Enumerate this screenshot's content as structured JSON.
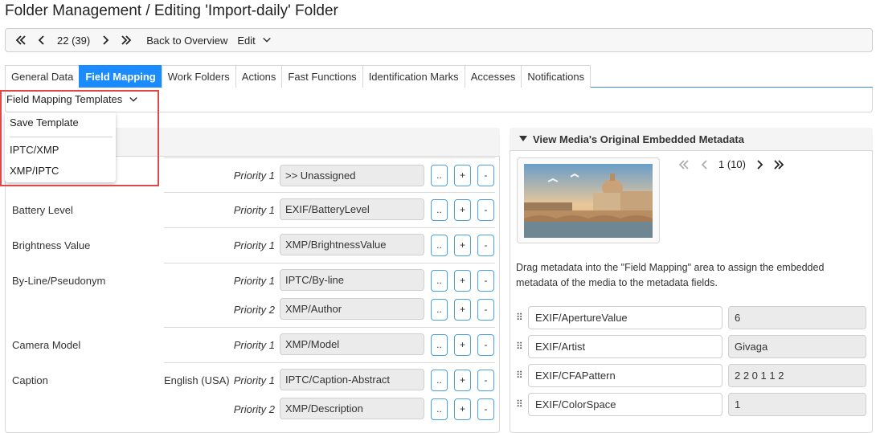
{
  "page": {
    "title": "Folder Management / Editing 'Import-daily' Folder"
  },
  "toolbar": {
    "first_icon": "double-chevron-left-icon",
    "prev_icon": "chevron-left-icon",
    "position": "22 (39)",
    "next_icon": "chevron-right-icon",
    "last_icon": "double-chevron-right-icon",
    "back": "Back to Overview",
    "edit": "Edit"
  },
  "tabs": [
    {
      "label": "General Data"
    },
    {
      "label": "Field Mapping",
      "active": true
    },
    {
      "label": "Work Folders"
    },
    {
      "label": "Actions"
    },
    {
      "label": "Fast Functions"
    },
    {
      "label": "Identification Marks"
    },
    {
      "label": "Accesses"
    },
    {
      "label": "Notifications"
    }
  ],
  "templates": {
    "button": "Field Mapping Templates",
    "menu": [
      "Save Template",
      "IPTC/XMP",
      "XMP/IPTC"
    ]
  },
  "mapping_rows": [
    {
      "field": "",
      "language": "",
      "priority": "Priority 1",
      "value": ">> Unassigned"
    },
    {
      "field": "Battery Level",
      "language": "",
      "priority": "Priority 1",
      "value": "EXIF/BatteryLevel"
    },
    {
      "field": "Brightness Value",
      "language": "",
      "priority": "Priority 1",
      "value": "XMP/BrightnessValue"
    },
    {
      "field": "By-Line/Pseudonym",
      "language": "",
      "priority": "Priority 1",
      "value": "IPTC/By-line"
    },
    {
      "field": "",
      "language": "",
      "priority": "Priority 2",
      "value": "XMP/Author"
    },
    {
      "field": "Camera Model",
      "language": "",
      "priority": "Priority 1",
      "value": "XMP/Model"
    },
    {
      "field": "Caption",
      "language": "English (USA)",
      "priority": "Priority 1",
      "value": "IPTC/Caption-Abstract"
    },
    {
      "field": "",
      "language": "",
      "priority": "Priority 2",
      "value": "XMP/Description"
    }
  ],
  "row_buttons": {
    "browse": "..",
    "add": "+",
    "remove": "-"
  },
  "metadata_panel": {
    "title": "View Media's Original Embedded Metadata",
    "pager": "1 (10)",
    "hint": "Drag metadata into the \"Field Mapping\" area to assign the embedded metadata of the media to the metadata fields.",
    "drag_icon": "drag-handle-icon",
    "items": [
      {
        "key": "EXIF/ApertureValue",
        "value": "6"
      },
      {
        "key": "EXIF/Artist",
        "value": "Givaga"
      },
      {
        "key": "EXIF/CFAPattern",
        "value": "2 2 0 1 1 2"
      },
      {
        "key": "EXIF/ColorSpace",
        "value": "1"
      }
    ]
  },
  "colors": {
    "accent": "#1a8cff",
    "highlight": "#e04848",
    "button_border": "#4aa3e0"
  }
}
